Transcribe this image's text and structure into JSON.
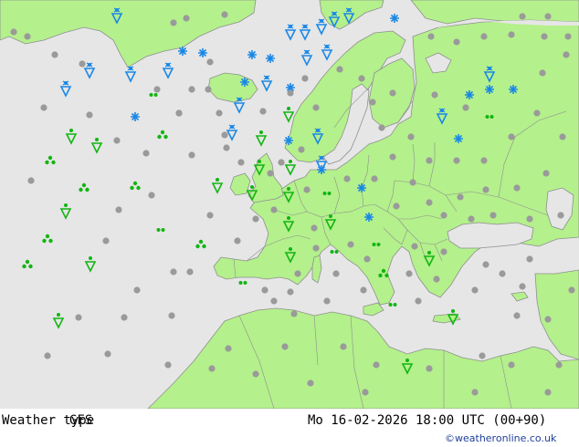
{
  "footer": {
    "title": "Weather type",
    "model": "GFS",
    "valid_time": "Mo 16-02-2026 18:00 UTC (00+90)",
    "credit": "©weatheronline.co.uk"
  },
  "colors": {
    "sea": "#e6e6e6",
    "land": "#b4f08c",
    "border": "#8f8f8f",
    "dry": "#9a9a9a",
    "rain": "#12b512",
    "snow": "#1a88e6"
  },
  "legend_types": [
    "dry",
    "rain",
    "shower",
    "drizzle",
    "snow",
    "snow-shower"
  ]
}
